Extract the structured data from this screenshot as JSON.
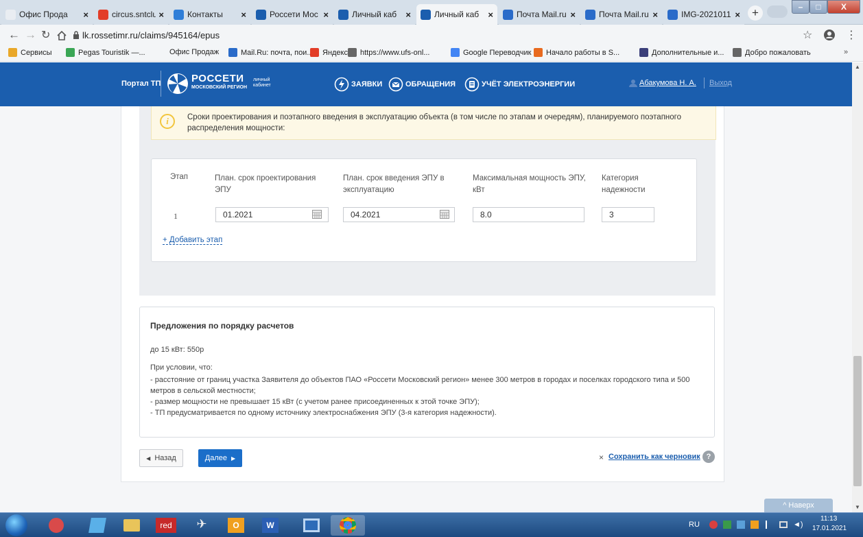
{
  "browser": {
    "tabs": [
      {
        "label": "Офис Прода",
        "icon": "page-icon",
        "color": "#e9edf2"
      },
      {
        "label": "circus.sntclub",
        "icon": "yandex-icon",
        "color": "#e23d28"
      },
      {
        "label": "Контакты",
        "icon": "globe-icon",
        "color": "#2f7ed8"
      },
      {
        "label": "Россети Мос",
        "icon": "rosseti-icon",
        "color": "#1b5eae"
      },
      {
        "label": "Личный каб",
        "icon": "rosseti-icon",
        "color": "#1b5eae"
      },
      {
        "label": "Личный каб",
        "icon": "rosseti-icon",
        "color": "#1b5eae"
      },
      {
        "label": "Почта Mail.ru",
        "icon": "mail-icon",
        "color": "#2a6bc9"
      },
      {
        "label": "Почта Mail.ru",
        "icon": "mail-icon",
        "color": "#2a6bc9"
      },
      {
        "label": "IMG-2021011",
        "icon": "mail-icon",
        "color": "#2a6bc9"
      }
    ],
    "url": "lk.rossetimr.ru/claims/945164/epus",
    "bookmarks": [
      {
        "label": "Сервисы",
        "color": "#e9a82a"
      },
      {
        "label": "Pegas Touristik —...",
        "color": "#3aa655"
      },
      {
        "label": "Офис Продаж",
        "color": ""
      },
      {
        "label": "Mail.Ru: почта, пои...",
        "color": "#2a6bc9"
      },
      {
        "label": "Яндекс",
        "color": "#e23d28"
      },
      {
        "label": "https://www.ufs-onl...",
        "color": "#666666"
      },
      {
        "label": "Google Переводчик",
        "color": "#4285f4"
      },
      {
        "label": "Начало работы в S...",
        "color": "#e86a1f"
      },
      {
        "label": "Дополнительные и...",
        "color": "#3b3f7a"
      },
      {
        "label": "Добро пожаловать",
        "color": "#666666"
      }
    ]
  },
  "header": {
    "portal": "Портал ТП",
    "brand_title": "РОССЕТИ",
    "brand_sub": "МОСКОВСКИЙ РЕГИОН",
    "cabinet_line1": "личный",
    "cabinet_line2": "кабинет",
    "nav": [
      "ЗАЯВКИ",
      "ОБРАЩЕНИЯ",
      "УЧЁТ ЭЛЕКТРОЭНЕРГИИ"
    ],
    "user": "Абакумова Н. А.",
    "logout": "Выход"
  },
  "notice": "Сроки проектирования и поэтапного введения в эксплуатацию объекта (в том числе по этапам и очередям), планируемого поэтапного распределения мощности:",
  "stages": {
    "columns": [
      "Этап",
      "План. срок проектирования ЭПУ",
      "План. срок введения ЭПУ в эксплуатацию",
      "Максимальная мощность ЭПУ, кВт",
      "Категория надежности"
    ],
    "rows": [
      {
        "stage": "1",
        "design": "01.2021",
        "commission": "04.2021",
        "power": "8.0",
        "category": "3"
      }
    ],
    "add_label": "+ Добавить этап"
  },
  "proposal": {
    "title": "Предложения по порядку расчетов",
    "price": "до 15 кВт: 550р",
    "conditions_title": "При условии, что:",
    "conditions": [
      "- расстояние от границ участка Заявителя до объектов ПАО «Россети Московский регион» менее 300 метров в городах и поселках городского типа и 500 метров в сельской местности;",
      "- размер мощности не превышает 15 кВт (с учетом ранее присоединенных к этой точке ЭПУ);",
      "- ТП предусматривается по одному источнику электроснабжения ЭПУ (3-я категория надежности)."
    ]
  },
  "actions": {
    "back": "Назад",
    "next": "Далее",
    "save_draft": "Сохранить как черновик",
    "help": "?",
    "to_top": "Наверх"
  },
  "taskbar": {
    "lang": "RU",
    "time": "11:13",
    "date": "17.01.2021"
  },
  "colors": {
    "brand_blue": "#1b5eae",
    "notice_bg": "#fdf8e6",
    "notice_icon": "#f2c53d",
    "link": "#1b5eae"
  }
}
